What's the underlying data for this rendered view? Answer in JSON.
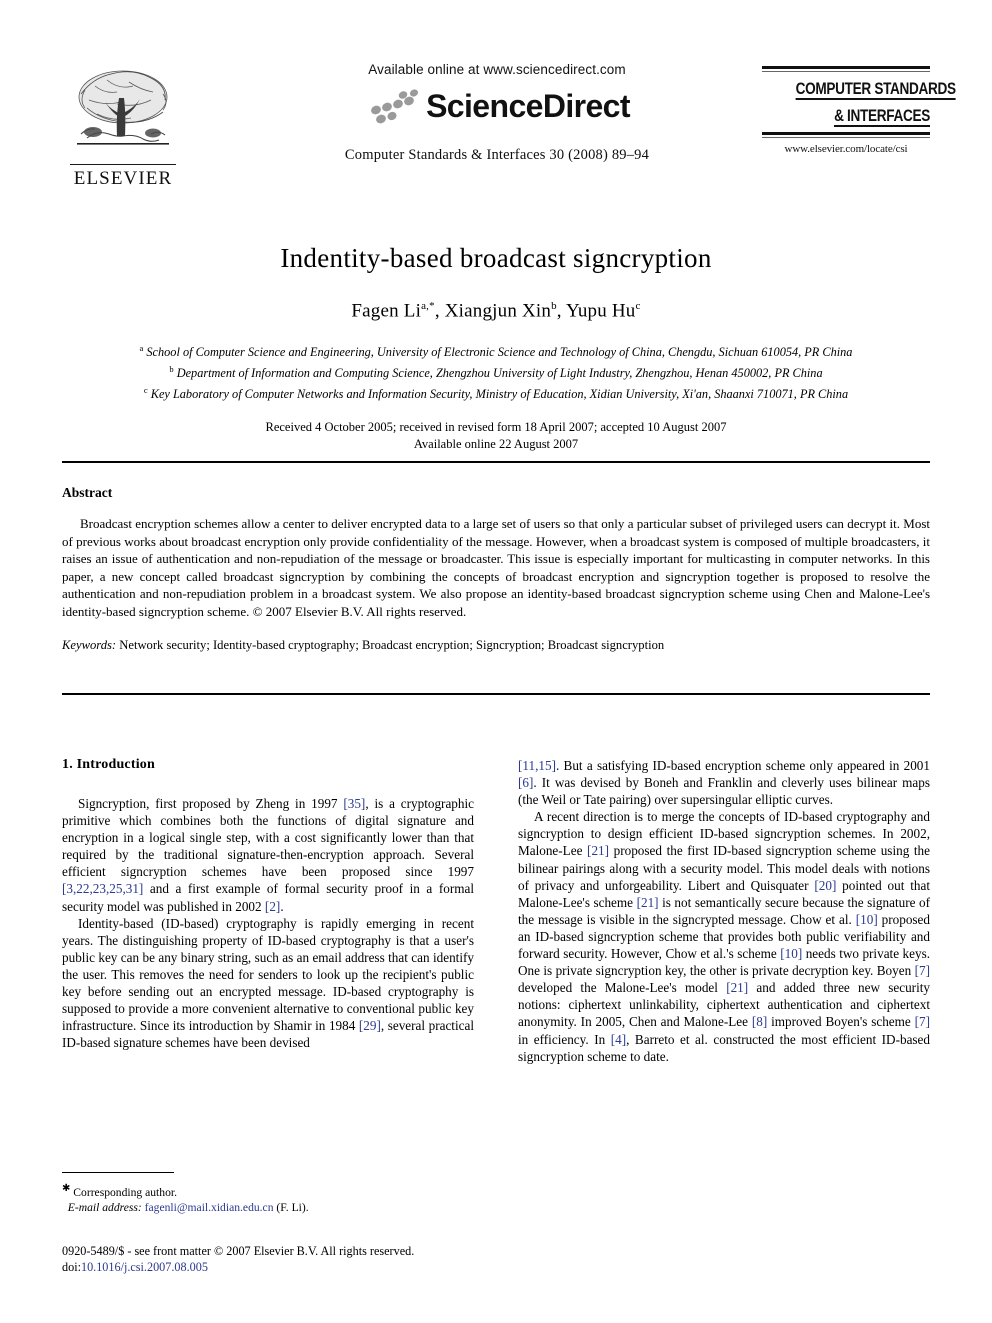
{
  "masthead": {
    "publisher_name": "ELSEVIER",
    "publisher_logo_alt": "elsevier-tree-logo",
    "available_online": "Available online at www.sciencedirect.com",
    "sciencedirect_word": "ScienceDirect",
    "journal_citation": "Computer Standards & Interfaces 30 (2008) 89–94",
    "cover_title_line1": "COMPUTER STANDARDS",
    "cover_title_line2": "& INTERFACES",
    "journal_url": "www.elsevier.com/locate/csi"
  },
  "title_block": {
    "title": "Indentity-based broadcast signcryption",
    "authors": "Fagen Li a,*, Xiangjun Xin b, Yupu Hu c",
    "author_parts": [
      {
        "name": "Fagen Li",
        "sup": "a,*"
      },
      {
        "name": "Xiangjun Xin",
        "sup": "b"
      },
      {
        "name": "Yupu Hu",
        "sup": "c"
      }
    ],
    "affiliations": [
      {
        "mark": "a",
        "text": "School of Computer Science and Engineering, University of Electronic Science and Technology of China, Chengdu, Sichuan 610054, PR China"
      },
      {
        "mark": "b",
        "text": "Department of Information and Computing Science, Zhengzhou University of Light Industry, Zhengzhou, Henan 450002, PR China"
      },
      {
        "mark": "c",
        "text": "Key Laboratory of Computer Networks and Information Security, Ministry of Education, Xidian University, Xi'an, Shaanxi 710071, PR China"
      }
    ],
    "dates_line1": "Received 4 October 2005; received in revised form 18 April 2007; accepted 10 August 2007",
    "dates_line2": "Available online 22 August 2007"
  },
  "abstract": {
    "heading": "Abstract",
    "body": "Broadcast encryption schemes allow a center to deliver encrypted data to a large set of users so that only a particular subset of privileged users can decrypt it. Most of previous works about broadcast encryption only provide confidentiality of the message. However, when a broadcast system is composed of multiple broadcasters, it raises an issue of authentication and non-repudiation of the message or broadcaster. This issue is especially important for multicasting in computer networks. In this paper, a new concept called broadcast signcryption by combining the concepts of broadcast encryption and signcryption together is proposed to resolve the authentication and non-repudiation problem in a broadcast system. We also propose an identity-based broadcast signcryption scheme using Chen and Malone-Lee's identity-based signcryption scheme.",
    "copyright": "© 2007 Elsevier B.V. All rights reserved.",
    "keywords_label": "Keywords:",
    "keywords_value": "Network security; Identity-based cryptography; Broadcast encryption; Signcryption; Broadcast signcryption"
  },
  "introduction": {
    "heading": "1. Introduction",
    "left_paragraphs": [
      {
        "segments": [
          {
            "t": "Signcryption, first proposed by Zheng in 1997 ",
            "cite": false
          },
          {
            "t": "[35]",
            "cite": true
          },
          {
            "t": ", is a cryptographic primitive which combines both the functions of digital signature and encryption in a logical single step, with a cost significantly lower than that required by the traditional signature-then-encryption approach. Several efficient signcryption schemes have been proposed since 1997 ",
            "cite": false
          },
          {
            "t": "[3,22,23,25,31]",
            "cite": true
          },
          {
            "t": " and a first example of formal security proof in a formal security model was published in 2002 ",
            "cite": false
          },
          {
            "t": "[2]",
            "cite": true
          },
          {
            "t": ".",
            "cite": false
          }
        ]
      },
      {
        "segments": [
          {
            "t": "Identity-based (ID-based) cryptography is rapidly emerging in recent years. The distinguishing property of ID-based cryptography is that a user's public key can be any binary string, such as an email address that can identify the user. This removes the need for senders to look up the recipient's public key before sending out an encrypted message. ID-based cryptography is supposed to provide a more convenient alternative to conventional public key infrastructure. Since its introduction by Shamir in 1984 ",
            "cite": false
          },
          {
            "t": "[29]",
            "cite": true
          },
          {
            "t": ", several practical ID-based signature schemes have been devised",
            "cite": false
          }
        ]
      }
    ],
    "right_paragraphs": [
      {
        "indent": false,
        "segments": [
          {
            "t": "[11,15]",
            "cite": true
          },
          {
            "t": ". But a satisfying ID-based encryption scheme only appeared in 2001 ",
            "cite": false
          },
          {
            "t": "[6]",
            "cite": true
          },
          {
            "t": ". It was devised by Boneh and Franklin and cleverly uses bilinear maps (the Weil or Tate pairing) over supersingular elliptic curves.",
            "cite": false
          }
        ]
      },
      {
        "indent": true,
        "segments": [
          {
            "t": "A recent direction is to merge the concepts of ID-based cryptography and signcryption to design efficient ID-based signcryption schemes. In 2002, Malone-Lee ",
            "cite": false
          },
          {
            "t": "[21]",
            "cite": true
          },
          {
            "t": " proposed the first ID-based signcryption scheme using the bilinear pairings along with a security model. This model deals with notions of privacy and unforgeability. Libert and Quisquater ",
            "cite": false
          },
          {
            "t": "[20]",
            "cite": true
          },
          {
            "t": " pointed out that Malone-Lee's scheme ",
            "cite": false
          },
          {
            "t": "[21]",
            "cite": true
          },
          {
            "t": " is not semantically secure because the signature of the message is visible in the signcrypted message. Chow et al. ",
            "cite": false
          },
          {
            "t": "[10]",
            "cite": true
          },
          {
            "t": " proposed an ID-based signcryption scheme that provides both public verifiability and forward security. However, Chow et al.'s scheme ",
            "cite": false
          },
          {
            "t": "[10]",
            "cite": true
          },
          {
            "t": " needs two private keys. One is private signcryption key, the other is private decryption key. Boyen ",
            "cite": false
          },
          {
            "t": "[7]",
            "cite": true
          },
          {
            "t": " developed the Malone-Lee's model ",
            "cite": false
          },
          {
            "t": "[21]",
            "cite": true
          },
          {
            "t": " and added three new security notions: ciphertext unlinkability, ciphertext authentication and ciphertext anonymity. In 2005, Chen and Malone-Lee ",
            "cite": false
          },
          {
            "t": "[8]",
            "cite": true
          },
          {
            "t": " improved Boyen's scheme ",
            "cite": false
          },
          {
            "t": "[7]",
            "cite": true
          },
          {
            "t": " in efficiency. In ",
            "cite": false
          },
          {
            "t": "[4]",
            "cite": true
          },
          {
            "t": ", Barreto et al. constructed the most efficient ID-based signcryption scheme to date.",
            "cite": false
          }
        ]
      }
    ]
  },
  "footnote": {
    "corresponding_author": "Corresponding author.",
    "email_label": "E-mail address:",
    "email_value": "fagenli@mail.xidian.edu.cn",
    "email_suffix": "(F. Li)."
  },
  "footer": {
    "issn_line": "0920-5489/$ - see front matter © 2007 Elsevier B.V. All rights reserved.",
    "doi_label": "doi:",
    "doi_value": "10.1016/j.csi.2007.08.005"
  },
  "colors": {
    "link": "#2b3990",
    "text": "#000000",
    "rule": "#000000"
  }
}
